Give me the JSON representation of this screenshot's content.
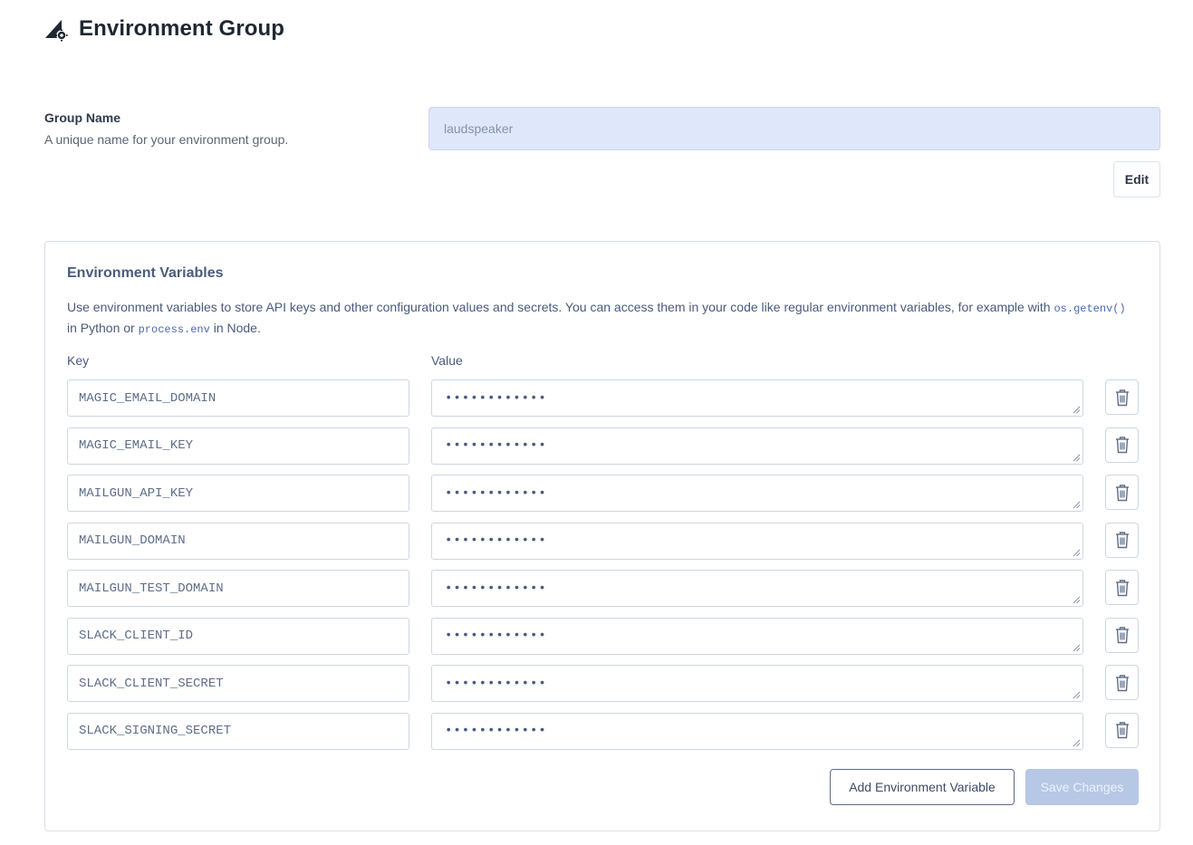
{
  "header": {
    "title": "Environment Group",
    "icon": "environment-group-icon"
  },
  "group_name": {
    "label": "Group Name",
    "description": "A unique name for your environment group.",
    "value": "laudspeaker",
    "edit_label": "Edit"
  },
  "env_vars": {
    "title": "Environment Variables",
    "desc_part1": "Use environment variables to store API keys and other configuration values and secrets. You can access them in your code like regular environment variables, for example with ",
    "code1": "os.getenv()",
    "desc_part2": " in Python or ",
    "code2": "process.env",
    "desc_part3": " in Node.",
    "key_header": "Key",
    "value_header": "Value",
    "rows": [
      {
        "key": "MAGIC_EMAIL_DOMAIN",
        "value": "••••••••••••"
      },
      {
        "key": "MAGIC_EMAIL_KEY",
        "value": "••••••••••••"
      },
      {
        "key": "MAILGUN_API_KEY",
        "value": "••••••••••••"
      },
      {
        "key": "MAILGUN_DOMAIN",
        "value": "••••••••••••"
      },
      {
        "key": "MAILGUN_TEST_DOMAIN",
        "value": "••••••••••••"
      },
      {
        "key": "SLACK_CLIENT_ID",
        "value": "••••••••••••"
      },
      {
        "key": "SLACK_CLIENT_SECRET",
        "value": "••••••••••••"
      },
      {
        "key": "SLACK_SIGNING_SECRET",
        "value": "••••••••••••"
      }
    ],
    "add_label": "Add Environment Variable",
    "save_label": "Save Changes"
  },
  "colors": {
    "accent": "#4a5b7c",
    "input_disabled_bg": "#dfe8fa",
    "save_disabled_bg": "#b7c7e6"
  }
}
